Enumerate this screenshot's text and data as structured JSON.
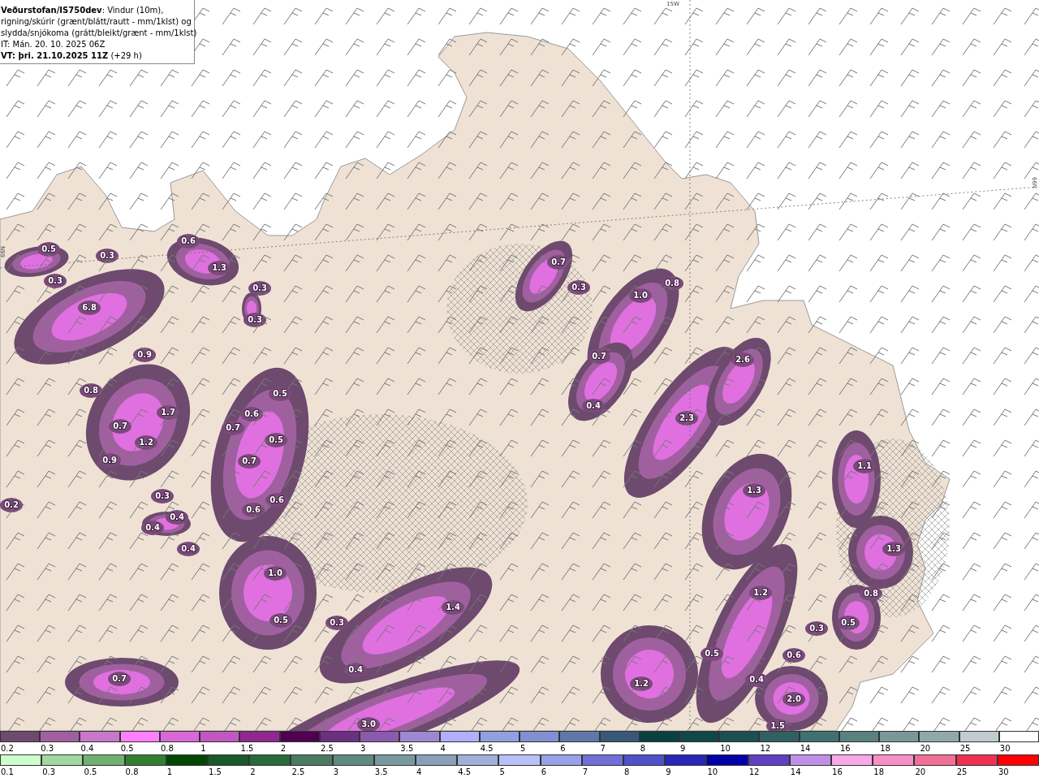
{
  "info_box": {
    "lines": [
      "**Veðurstofan/IS750dev**: Vindur (10m),",
      "rigning/skúrir (grænt/blátt/rautt - mm/1klst) og",
      "slydda/snjókoma (grátt/bleikt/grænt - mm/1klst)",
      "IT: Mán. 20. 10. 2025 06Z",
      "**VT: þri. 21.10.2025 11Z** (+29 h)"
    ]
  },
  "map": {
    "grid_labels": [
      "15W",
      "66N",
      "66N"
    ],
    "value_labels": [
      "0.5",
      "0.3",
      "0.6",
      "1.3",
      "0.3",
      "0.3",
      "0.3",
      "6.8",
      "0.9",
      "0.8",
      "1.7",
      "0.7",
      "1.2",
      "0.9",
      "0.3",
      "0.4",
      "0.4",
      "0.4",
      "0.2",
      "0.5",
      "0.6",
      "0.7",
      "0.5",
      "0.7",
      "0.6",
      "0.6",
      "1.0",
      "0.5",
      "0.3",
      "0.4",
      "1.4",
      "0.7",
      "3.0",
      "0.7",
      "0.3",
      "0.8",
      "1.0",
      "0.7",
      "0.4",
      "2.6",
      "2.3",
      "1.3",
      "1.1",
      "1.3",
      "0.8",
      "0.5",
      "0.3",
      "1.2",
      "0.5",
      "0.4",
      "0.6",
      "2.0",
      "1.2",
      "1.5"
    ]
  },
  "legend_rows": [
    {
      "items": [
        {
          "label": "0.2",
          "color": "#6e4a6e"
        },
        {
          "label": "0.3",
          "color": "#a060a0"
        },
        {
          "label": "0.4",
          "color": "#c878c8"
        },
        {
          "label": "0.5",
          "color": "#ff80ff"
        },
        {
          "label": "0.8",
          "color": "#d868d8"
        },
        {
          "label": "1",
          "color": "#c058c0"
        },
        {
          "label": "1.5",
          "color": "#902890"
        },
        {
          "label": "2",
          "color": "#500050"
        },
        {
          "label": "2.5",
          "color": "#6a3080"
        },
        {
          "label": "3",
          "color": "#8a5aae"
        },
        {
          "label": "3.5",
          "color": "#a088d0"
        },
        {
          "label": "4",
          "color": "#b0b0ff"
        },
        {
          "label": "4.5",
          "color": "#90a0e0"
        },
        {
          "label": "5",
          "color": "#8090d0"
        },
        {
          "label": "6",
          "color": "#6078a8"
        },
        {
          "label": "7",
          "color": "#385878"
        },
        {
          "label": "8",
          "color": "#0a4040"
        },
        {
          "label": "9",
          "color": "#104848"
        },
        {
          "label": "10",
          "color": "#1c5050"
        },
        {
          "label": "12",
          "color": "#306060"
        },
        {
          "label": "14",
          "color": "#407070"
        },
        {
          "label": "16",
          "color": "#5a8080"
        },
        {
          "label": "18",
          "color": "#7a9898"
        },
        {
          "label": "20",
          "color": "#90a8a8"
        },
        {
          "label": "25",
          "color": "#c0ccd0"
        },
        {
          "label": "30",
          "color": "#ffffff"
        }
      ]
    },
    {
      "items": [
        {
          "label": "0.1",
          "color": "#ccffcc"
        },
        {
          "label": "0.3",
          "color": "#a0d8a0"
        },
        {
          "label": "0.5",
          "color": "#70b070"
        },
        {
          "label": "0.8",
          "color": "#308030"
        },
        {
          "label": "1",
          "color": "#004800"
        },
        {
          "label": "1.5",
          "color": "#1a5a2a"
        },
        {
          "label": "2",
          "color": "#2a6a3a"
        },
        {
          "label": "2.5",
          "color": "#4a7a60"
        },
        {
          "label": "3",
          "color": "#608a80"
        },
        {
          "label": "3.5",
          "color": "#7a98a0"
        },
        {
          "label": "4",
          "color": "#8aa0b8"
        },
        {
          "label": "4.5",
          "color": "#a0b0d8"
        },
        {
          "label": "5",
          "color": "#b8c0f8"
        },
        {
          "label": "6",
          "color": "#98a0e8"
        },
        {
          "label": "7",
          "color": "#7070d8"
        },
        {
          "label": "8",
          "color": "#5050c8"
        },
        {
          "label": "9",
          "color": "#2828b8"
        },
        {
          "label": "10",
          "color": "#0000a8"
        },
        {
          "label": "12",
          "color": "#6040c0"
        },
        {
          "label": "14",
          "color": "#c090e8"
        },
        {
          "label": "16",
          "color": "#f8a8e8"
        },
        {
          "label": "18",
          "color": "#f890c8"
        },
        {
          "label": "20",
          "color": "#f07098"
        },
        {
          "label": "25",
          "color": "#f03050"
        },
        {
          "label": "30",
          "color": "#ff0000"
        }
      ]
    }
  ]
}
